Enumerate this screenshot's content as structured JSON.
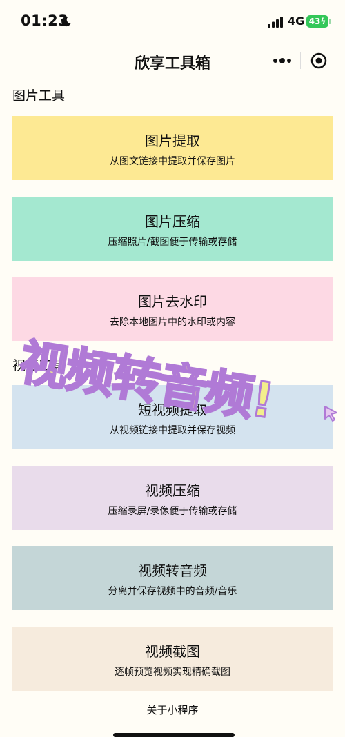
{
  "status": {
    "time": "01:23",
    "network": "4G",
    "battery": "43"
  },
  "nav": {
    "title": "欣享工具箱"
  },
  "sections": [
    {
      "title": "图片工具",
      "cards": [
        {
          "title": "图片提取",
          "subtitle": "从图文链接中提取并保存图片",
          "color": "#fde993"
        },
        {
          "title": "图片压缩",
          "subtitle": "压缩照片/截图便于传输或存储",
          "color": "#a4e8d0"
        },
        {
          "title": "图片去水印",
          "subtitle": "去除本地图片中的水印或内容",
          "color": "#fdd9e4"
        }
      ]
    },
    {
      "title": "视频工具",
      "cards": [
        {
          "title": "短视频提取",
          "subtitle": "从视频链接中提取并保存视频",
          "color": "#d4e3ef"
        },
        {
          "title": "视频压缩",
          "subtitle": "压缩录屏/录像便于传输或存储",
          "color": "#e9dceb"
        },
        {
          "title": "视频转音频",
          "subtitle": "分离并保存视频中的音频/音乐",
          "color": "#c4d6d7"
        },
        {
          "title": "视频截图",
          "subtitle": "逐帧预览视频实现精确截图",
          "color": "#f6ebdd"
        }
      ]
    }
  ],
  "footer": {
    "about": "关于小程序"
  },
  "overlay": {
    "text": "视频转音频!"
  },
  "icons": {
    "moon": "moon-icon",
    "signal": "signal-icon",
    "more": "more-icon",
    "target": "target-icon",
    "cursor": "cursor-icon"
  }
}
